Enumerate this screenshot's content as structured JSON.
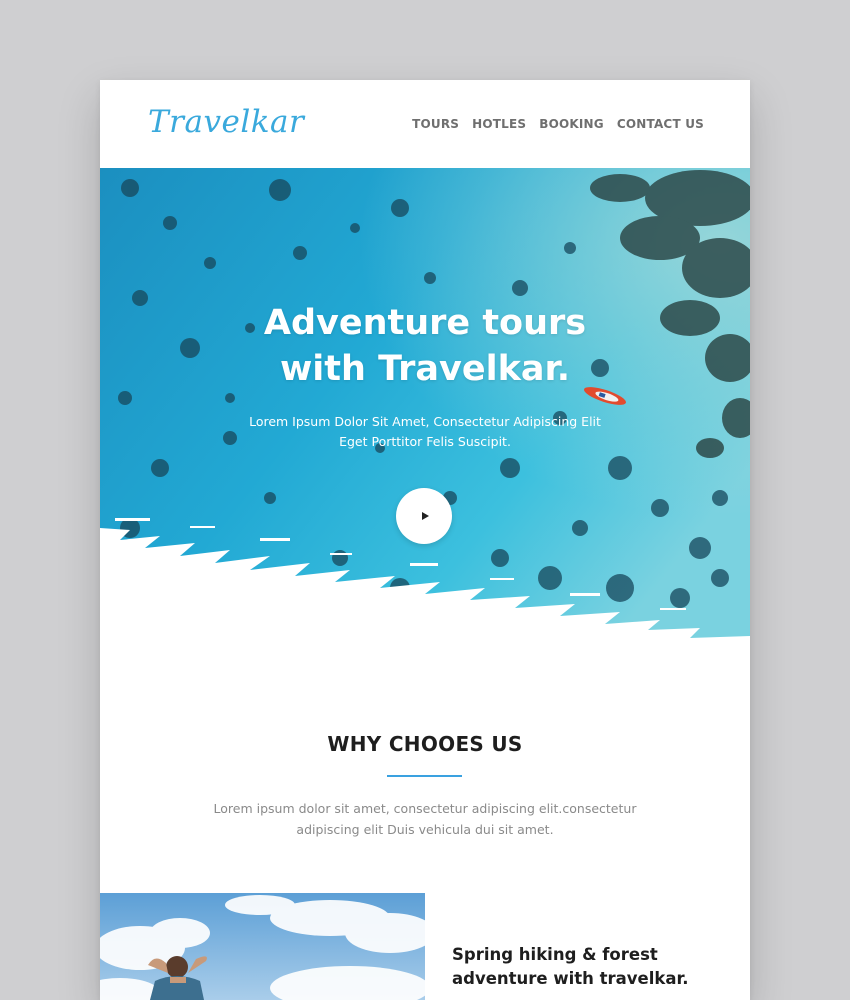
{
  "brand": {
    "logo_text": "Travelkar",
    "accent": "#3aa9dc"
  },
  "nav": {
    "items": [
      {
        "label": "TOURS"
      },
      {
        "label": "HOTLES"
      },
      {
        "label": "BOOKING"
      },
      {
        "label": "CONTACT US"
      }
    ]
  },
  "hero": {
    "title_line1": "Adventure tours",
    "title_line2": "with Travelkar.",
    "subtitle_line1": "Lorem Ipsum Dolor Sit Amet, Consectetur Adipiscing Elit",
    "subtitle_line2": "Eget Porttitor Felis Suscipit.",
    "play_icon": "play-icon",
    "background_color": "#1ea4cf"
  },
  "why": {
    "title": "WHY CHOOES US",
    "text_line1": "Lorem ipsum dolor sit amet, consectetur adipiscing elit.consectetur",
    "text_line2": "adipiscing elit Duis vehicula dui sit amet.",
    "rule_color": "#3aa1e0"
  },
  "feature": {
    "title_line1": "Spring hiking & forest",
    "title_line2": "adventure with travelkar."
  }
}
